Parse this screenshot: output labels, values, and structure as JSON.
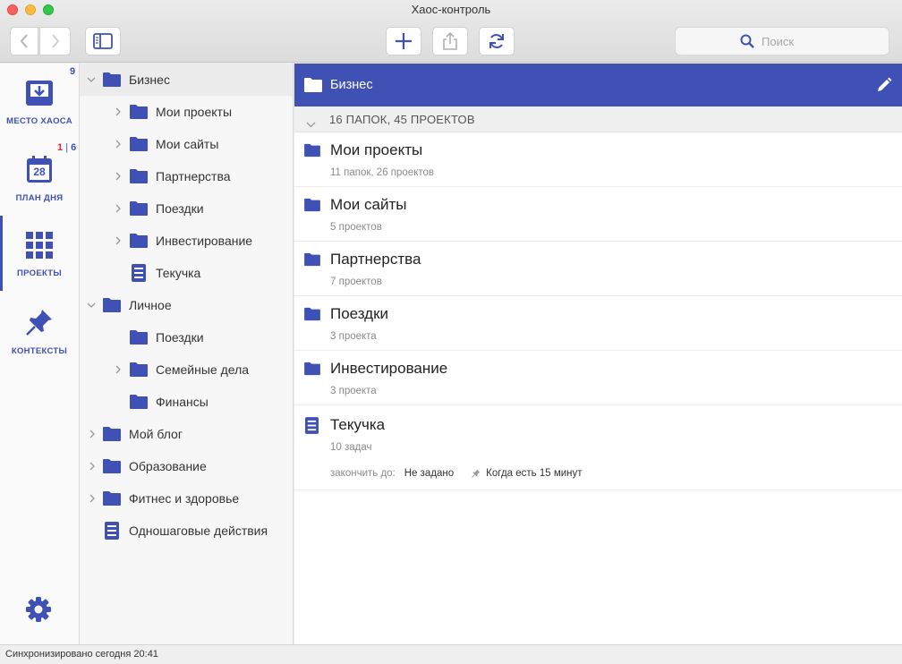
{
  "window": {
    "title": "Хаос-контроль"
  },
  "toolbar": {
    "search_placeholder": "Поиск"
  },
  "rail": {
    "items": [
      {
        "label": "МЕСТО ХАОСА",
        "badge": "9"
      },
      {
        "label": "ПЛАН ДНЯ",
        "badge_red": "1",
        "badge_sep": "|",
        "badge_blue": "6",
        "calendar_day": "28"
      },
      {
        "label": "ПРОЕКТЫ"
      },
      {
        "label": "КОНТЕКСТЫ"
      }
    ]
  },
  "tree": {
    "items": [
      {
        "label": "Бизнес"
      },
      {
        "label": "Мои проекты"
      },
      {
        "label": "Мои сайты"
      },
      {
        "label": "Партнерства"
      },
      {
        "label": "Поездки"
      },
      {
        "label": "Инвестирование"
      },
      {
        "label": "Текучка"
      },
      {
        "label": "Личное"
      },
      {
        "label": "Поездки"
      },
      {
        "label": "Семейные дела"
      },
      {
        "label": "Финансы"
      },
      {
        "label": "Мой блог"
      },
      {
        "label": "Образование"
      },
      {
        "label": "Фитнес и здоровье"
      },
      {
        "label": "Одношаговые действия"
      }
    ]
  },
  "main": {
    "header_title": "Бизнес",
    "summary": "16 ПАПОК, 45 ПРОЕКТОВ",
    "items": [
      {
        "title": "Мои проекты",
        "subtitle": "11 папок, 26 проектов"
      },
      {
        "title": "Мои сайты",
        "subtitle": "5 проектов"
      },
      {
        "title": "Партнерства",
        "subtitle": "7 проектов"
      },
      {
        "title": "Поездки",
        "subtitle": "3 проекта"
      },
      {
        "title": "Инвестирование",
        "subtitle": "3 проекта"
      },
      {
        "title": "Текучка",
        "subtitle": "10 задач",
        "deadline_label": "закончить до:",
        "deadline_value": "Не задано",
        "context": "Когда есть 15 минут"
      }
    ]
  },
  "status": {
    "text": "Синхронизировано сегодня 20:41"
  },
  "colors": {
    "accent": "#3f51b5",
    "badge_red": "#e0283a"
  }
}
